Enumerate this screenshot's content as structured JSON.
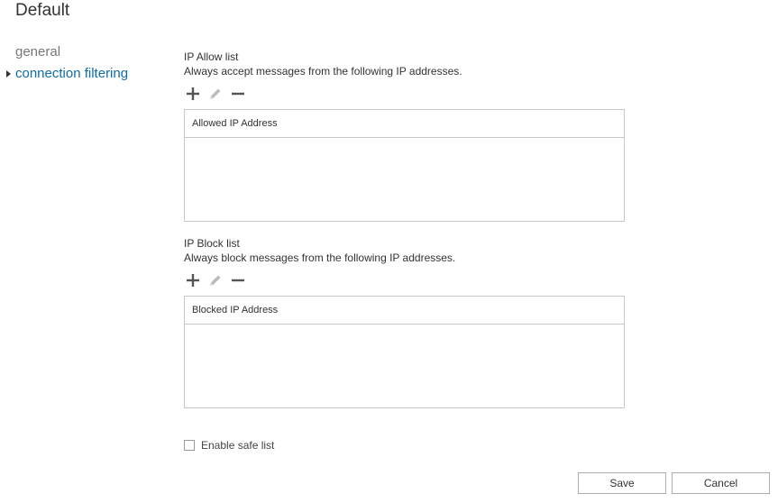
{
  "page": {
    "title": "Default"
  },
  "nav": {
    "items": [
      {
        "label": "general",
        "active": false
      },
      {
        "label": "connection filtering",
        "active": true
      }
    ]
  },
  "allow": {
    "title": "IP Allow list",
    "description": "Always accept messages from the following IP addresses.",
    "column_header": "Allowed IP Address",
    "rows": []
  },
  "block": {
    "title": "IP Block list",
    "description": "Always block messages from the following IP addresses.",
    "column_header": "Blocked IP Address",
    "rows": []
  },
  "safe_list": {
    "label": "Enable safe list",
    "checked": false
  },
  "buttons": {
    "save": "Save",
    "cancel": "Cancel"
  },
  "colors": {
    "accent": "#0f6ca8",
    "border": "#c8c8c8",
    "icon_active": "#555555",
    "icon_disabled": "#bbbbbb"
  },
  "icons": {
    "add": "plus-icon",
    "edit": "pencil-icon",
    "remove": "minus-icon"
  }
}
